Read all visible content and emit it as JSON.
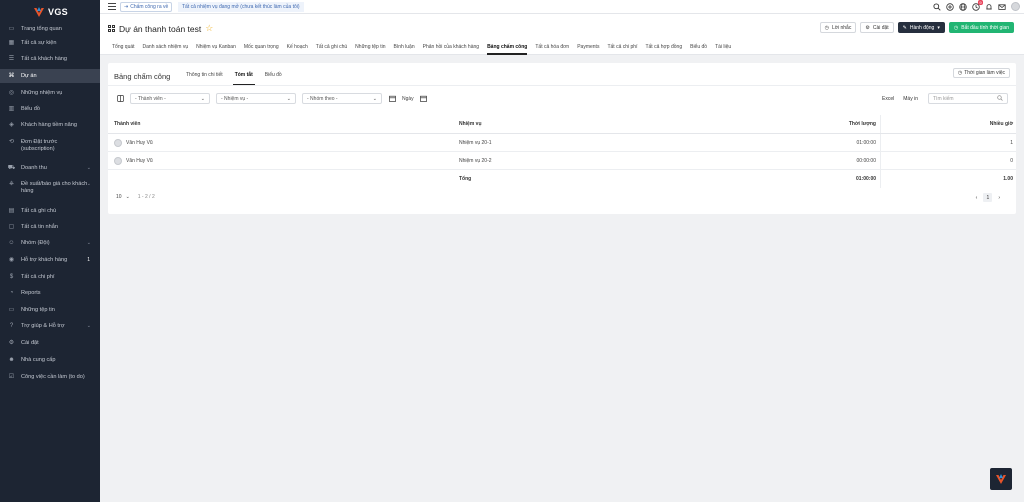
{
  "brand": {
    "logo_text": "VGS"
  },
  "sidebar": {
    "items": [
      {
        "label": "Trang tổng quan",
        "icon": "monitor-icon"
      },
      {
        "label": "Tất cả sự kiện",
        "icon": "calendar-icon"
      },
      {
        "label": "Tất cả khách hàng",
        "icon": "users-icon"
      },
      {
        "label": "Dự án",
        "icon": "command-icon",
        "active": true
      },
      {
        "label": "Những nhiệm vụ",
        "icon": "check-circle-icon"
      },
      {
        "label": "Biểu đồ",
        "icon": "chart-icon"
      },
      {
        "label": "Khách hàng tiềm năng",
        "icon": "layers-icon"
      },
      {
        "label": "Đơn Đặt trước (subscription)",
        "icon": "repeat-icon"
      },
      {
        "label": "Doanh thu",
        "icon": "cart-icon",
        "arrow": true
      },
      {
        "label": "Đề xuất/báo giá cho khách hàng",
        "icon": "stamp-icon",
        "arrow": true
      },
      {
        "label": "Tất cả ghi chú",
        "icon": "book-icon"
      },
      {
        "label": "Tất cả tin nhắn",
        "icon": "message-icon"
      },
      {
        "label": "Nhóm (Đội)",
        "icon": "team-icon",
        "arrow": true
      },
      {
        "label": "Hỗ trợ khách hàng",
        "icon": "lifebuoy-icon",
        "badge": "1"
      },
      {
        "label": "Tất cả chi phí",
        "icon": "dollar-icon"
      },
      {
        "label": "Reports",
        "icon": "pie-icon"
      },
      {
        "label": "Những tệp tin",
        "icon": "folder-icon"
      },
      {
        "label": "Trợ giúp & Hỗ trợ",
        "icon": "help-icon",
        "arrow": true
      },
      {
        "label": "Cài đặt",
        "icon": "settings-icon"
      },
      {
        "label": "Nhà cung cấp",
        "icon": "user-icon"
      },
      {
        "label": "Công việc cần làm (to do)",
        "icon": "todo-icon"
      }
    ]
  },
  "topbar": {
    "checkin_label": "Chấm công ra về",
    "notice": "Tất cả nhiệm vụ đang mở (chưa kết thúc làm của tôi)",
    "notification_badge": "9"
  },
  "header": {
    "title": "Dự án thanh toán test",
    "reminder_label": "Lời nhắc",
    "settings_label": "Cài đặt",
    "actions_label": "Hành động",
    "start_timer_label": "Bắt đầu tính thời gian"
  },
  "tabs": [
    {
      "label": "Tổng quát"
    },
    {
      "label": "Danh sách nhiệm vụ"
    },
    {
      "label": "Nhiệm vụ Kanban"
    },
    {
      "label": "Mốc quan trọng"
    },
    {
      "label": "Kế hoạch"
    },
    {
      "label": "Tất cả ghi chú"
    },
    {
      "label": "Những tệp tin"
    },
    {
      "label": "Bình luận"
    },
    {
      "label": "Phản hồi của khách hàng"
    },
    {
      "label": "Bảng chấm công",
      "active": true
    },
    {
      "label": "Tất cả hóa đơn"
    },
    {
      "label": "Payments"
    },
    {
      "label": "Tất cả chi phí"
    },
    {
      "label": "Tất cả hợp đồng"
    },
    {
      "label": "Biểu đồ"
    },
    {
      "label": "Tài liệu"
    }
  ],
  "card": {
    "title": "Bảng chấm công",
    "subtabs": [
      {
        "label": "Thông tin chi tiết"
      },
      {
        "label": "Tóm tắt",
        "active": true
      },
      {
        "label": "Biểu đồ"
      }
    ],
    "worktime_label": "Thời gian làm việc"
  },
  "filters": {
    "member_placeholder": "- Thành viên -",
    "task_placeholder": "- Nhiệm vụ -",
    "group_placeholder": "- Nhóm theo -",
    "date_label": "Ngày",
    "excel_label": "Excel",
    "print_label": "Máy in",
    "search_placeholder": "Tìm kiếm"
  },
  "table": {
    "columns": {
      "member": "Thành viên",
      "task": "Nhiệm vụ",
      "duration": "Thời lượng",
      "hours": "Nhiều giờ"
    },
    "rows": [
      {
        "member": "Văn Huy Vũ",
        "task": "Nhiệm vụ 20-1",
        "duration": "01:00:00",
        "hours": "1"
      },
      {
        "member": "Văn Huy Vũ",
        "task": "Nhiệm vụ 20-2",
        "duration": "00:00:00",
        "hours": "0"
      }
    ],
    "total": {
      "label": "Tổng",
      "duration": "01:00:00",
      "hours": "1.00"
    }
  },
  "pager": {
    "page_size": "10",
    "range": "1 - 2 / 2",
    "current_page": "1"
  },
  "colors": {
    "sidebar_bg": "#1d2533",
    "accent_green": "#22b573",
    "dark_button": "#262f3e",
    "badge_red": "#e9425a",
    "star": "#f0b429"
  }
}
